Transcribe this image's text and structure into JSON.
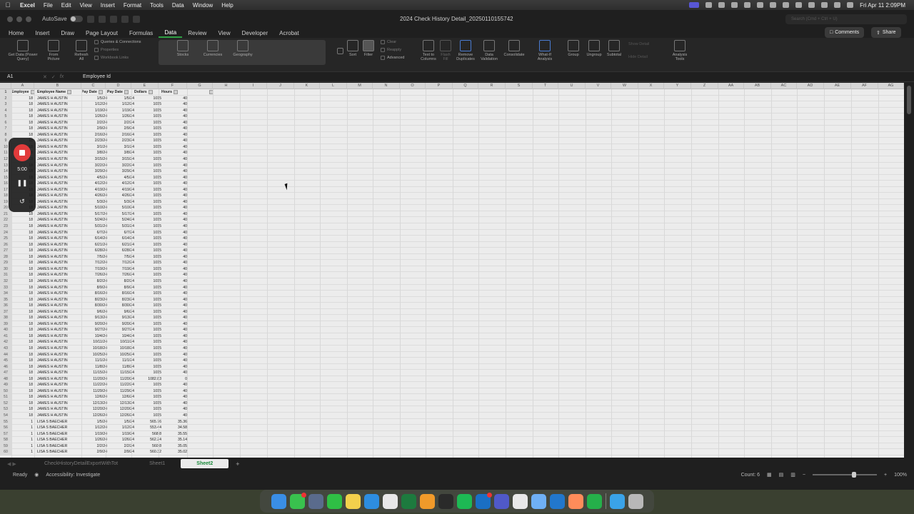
{
  "menubar": {
    "items": [
      "Excel",
      "File",
      "Edit",
      "View",
      "Insert",
      "Format",
      "Tools",
      "Data",
      "Window",
      "Help"
    ],
    "clock": "Fri Apr 11  2:09PM"
  },
  "window": {
    "autosave_label": "AutoSave",
    "title": "2024 Check History Detail_20250110155742",
    "search_placeholder": "Search (Cmd + Ctrl + U)"
  },
  "ribbon": {
    "tabs": [
      "Home",
      "Insert",
      "Draw",
      "Page Layout",
      "Formulas",
      "Data",
      "Review",
      "View",
      "Developer",
      "Acrobat"
    ],
    "active_tab": "Data",
    "comments_label": "Comments",
    "share_label": "Share",
    "get_data": "Get Data (Power\nQuery)",
    "from_picture": "From\nPicture",
    "refresh_all": "Refresh\nAll",
    "queries_connections": "Queries & Connections",
    "properties": "Properties",
    "workbook_links": "Workbook Links",
    "stocks": "Stocks",
    "currencies": "Currencies",
    "geography": "Geography",
    "sort": "Sort",
    "filter": "Filter",
    "clear": "Clear",
    "reapply": "Reapply",
    "advanced": "Advanced",
    "text_to_columns": "Text to\nColumns",
    "flash_fill": "Flash\nFill",
    "remove_duplicates": "Remove\nDuplicates",
    "data_validation": "Data\nValidation",
    "consolidate": "Consolidate",
    "what_if": "What-If\nAnalysis",
    "group": "Group",
    "ungroup": "Ungroup",
    "subtotal": "Subtotal",
    "show_detail": "Show Detail",
    "hide_detail": "Hide Detail",
    "analysis_tools": "Analysis\nTools"
  },
  "formula_bar": {
    "name_box": "A1",
    "fx": "fx",
    "value": "Employee Id"
  },
  "columns": [
    "A",
    "B",
    "C",
    "D",
    "E",
    "F",
    "G",
    "H",
    "I",
    "J",
    "K",
    "L",
    "M",
    "N",
    "O",
    "P",
    "Q",
    "R",
    "S",
    "T",
    "U",
    "V",
    "W",
    "X",
    "Y",
    "Z",
    "AA",
    "AB",
    "AC",
    "AD",
    "AE",
    "AF",
    "AG"
  ],
  "headers": [
    "Employee",
    "Employee Name",
    "Pay Date",
    "Pay Date",
    "Dollars",
    "Hours"
  ],
  "rows": [
    [
      "2",
      "18",
      "JAMES H AUSTIN",
      "1/5/24",
      "1/5/24",
      "1015",
      "40"
    ],
    [
      "3",
      "18",
      "JAMES H AUSTIN",
      "1/12/24",
      "1/12/24",
      "1015",
      "40"
    ],
    [
      "4",
      "18",
      "JAMES H AUSTIN",
      "1/19/24",
      "1/19/24",
      "1015",
      "40"
    ],
    [
      "5",
      "18",
      "JAMES H AUSTIN",
      "1/26/24",
      "1/26/24",
      "1015",
      "40"
    ],
    [
      "6",
      "18",
      "JAMES H AUSTIN",
      "2/2/24",
      "2/2/24",
      "1015",
      "40"
    ],
    [
      "7",
      "18",
      "JAMES H AUSTIN",
      "2/9/24",
      "2/9/24",
      "1015",
      "40"
    ],
    [
      "8",
      "18",
      "JAMES H AUSTIN",
      "2/16/24",
      "2/16/24",
      "1015",
      "40"
    ],
    [
      "9",
      "18",
      "JAMES H AUSTIN",
      "2/23/24",
      "2/23/24",
      "1015",
      "40"
    ],
    [
      "10",
      "18",
      "JAMES H AUSTIN",
      "3/1/24",
      "3/1/24",
      "1015",
      "40"
    ],
    [
      "11",
      "18",
      "JAMES H AUSTIN",
      "3/8/24",
      "3/8/24",
      "1015",
      "40"
    ],
    [
      "12",
      "18",
      "JAMES H AUSTIN",
      "3/15/24",
      "3/15/24",
      "1015",
      "40"
    ],
    [
      "13",
      "18",
      "JAMES H AUSTIN",
      "3/22/24",
      "3/22/24",
      "1015",
      "40"
    ],
    [
      "14",
      "18",
      "JAMES H AUSTIN",
      "3/29/24",
      "3/29/24",
      "1015",
      "40"
    ],
    [
      "15",
      "18",
      "JAMES H AUSTIN",
      "4/5/24",
      "4/5/24",
      "1015",
      "40"
    ],
    [
      "16",
      "18",
      "JAMES H AUSTIN",
      "4/12/24",
      "4/12/24",
      "1015",
      "40"
    ],
    [
      "17",
      "18",
      "JAMES H AUSTIN",
      "4/19/24",
      "4/19/24",
      "1015",
      "40"
    ],
    [
      "18",
      "18",
      "JAMES H AUSTIN",
      "4/26/24",
      "4/26/24",
      "1015",
      "40"
    ],
    [
      "19",
      "18",
      "JAMES H AUSTIN",
      "5/3/24",
      "5/3/24",
      "1015",
      "40"
    ],
    [
      "20",
      "18",
      "JAMES H AUSTIN",
      "5/10/24",
      "5/10/24",
      "1015",
      "40"
    ],
    [
      "21",
      "18",
      "JAMES H AUSTIN",
      "5/17/24",
      "5/17/24",
      "1015",
      "40"
    ],
    [
      "22",
      "18",
      "JAMES H AUSTIN",
      "5/24/24",
      "5/24/24",
      "1015",
      "40"
    ],
    [
      "23",
      "18",
      "JAMES H AUSTIN",
      "5/31/24",
      "5/31/24",
      "1015",
      "40"
    ],
    [
      "24",
      "18",
      "JAMES H AUSTIN",
      "6/7/24",
      "6/7/24",
      "1015",
      "40"
    ],
    [
      "25",
      "18",
      "JAMES H AUSTIN",
      "6/14/24",
      "6/14/24",
      "1015",
      "40"
    ],
    [
      "26",
      "18",
      "JAMES H AUSTIN",
      "6/21/24",
      "6/21/24",
      "1015",
      "40"
    ],
    [
      "27",
      "18",
      "JAMES H AUSTIN",
      "6/28/24",
      "6/28/24",
      "1015",
      "40"
    ],
    [
      "28",
      "18",
      "JAMES H AUSTIN",
      "7/5/24",
      "7/5/24",
      "1015",
      "40"
    ],
    [
      "29",
      "18",
      "JAMES H AUSTIN",
      "7/12/24",
      "7/12/24",
      "1015",
      "40"
    ],
    [
      "30",
      "18",
      "JAMES H AUSTIN",
      "7/19/24",
      "7/19/24",
      "1015",
      "40"
    ],
    [
      "31",
      "18",
      "JAMES H AUSTIN",
      "7/26/24",
      "7/26/24",
      "1015",
      "40"
    ],
    [
      "32",
      "18",
      "JAMES H AUSTIN",
      "8/2/24",
      "8/2/24",
      "1015",
      "40"
    ],
    [
      "33",
      "18",
      "JAMES H AUSTIN",
      "8/9/24",
      "8/9/24",
      "1015",
      "40"
    ],
    [
      "34",
      "18",
      "JAMES H AUSTIN",
      "8/16/24",
      "8/16/24",
      "1015",
      "40"
    ],
    [
      "35",
      "18",
      "JAMES H AUSTIN",
      "8/23/24",
      "8/23/24",
      "1015",
      "40"
    ],
    [
      "36",
      "18",
      "JAMES H AUSTIN",
      "8/30/24",
      "8/30/24",
      "1015",
      "40"
    ],
    [
      "37",
      "18",
      "JAMES H AUSTIN",
      "9/6/24",
      "9/6/24",
      "1015",
      "40"
    ],
    [
      "38",
      "18",
      "JAMES H AUSTIN",
      "9/13/24",
      "9/13/24",
      "1015",
      "40"
    ],
    [
      "39",
      "18",
      "JAMES H AUSTIN",
      "9/20/24",
      "9/20/24",
      "1015",
      "40"
    ],
    [
      "40",
      "18",
      "JAMES H AUSTIN",
      "9/27/24",
      "9/27/24",
      "1015",
      "40"
    ],
    [
      "41",
      "18",
      "JAMES H AUSTIN",
      "10/4/24",
      "10/4/24",
      "1015",
      "40"
    ],
    [
      "42",
      "18",
      "JAMES H AUSTIN",
      "10/11/24",
      "10/11/24",
      "1015",
      "40"
    ],
    [
      "43",
      "18",
      "JAMES H AUSTIN",
      "10/18/24",
      "10/18/24",
      "1015",
      "40"
    ],
    [
      "44",
      "18",
      "JAMES H AUSTIN",
      "10/25/24",
      "10/25/24",
      "1015",
      "40"
    ],
    [
      "45",
      "18",
      "JAMES H AUSTIN",
      "11/1/24",
      "11/1/24",
      "1015",
      "40"
    ],
    [
      "46",
      "18",
      "JAMES H AUSTIN",
      "11/8/24",
      "11/8/24",
      "1015",
      "40"
    ],
    [
      "47",
      "18",
      "JAMES H AUSTIN",
      "11/15/24",
      "11/15/24",
      "1015",
      "40"
    ],
    [
      "48",
      "18",
      "JAMES H AUSTIN",
      "11/20/24",
      "11/20/24",
      "1082.83",
      "0"
    ],
    [
      "49",
      "18",
      "JAMES H AUSTIN",
      "11/22/24",
      "11/22/24",
      "1015",
      "40"
    ],
    [
      "50",
      "18",
      "JAMES H AUSTIN",
      "11/29/24",
      "11/29/24",
      "1015",
      "40"
    ],
    [
      "51",
      "18",
      "JAMES H AUSTIN",
      "12/6/24",
      "12/6/24",
      "1015",
      "40"
    ],
    [
      "52",
      "18",
      "JAMES H AUSTIN",
      "12/13/24",
      "12/13/24",
      "1015",
      "40"
    ],
    [
      "53",
      "18",
      "JAMES H AUSTIN",
      "12/20/24",
      "12/20/24",
      "1015",
      "40"
    ],
    [
      "54",
      "18",
      "JAMES H AUSTIN",
      "12/26/24",
      "12/26/24",
      "1015",
      "40"
    ],
    [
      "55",
      "1",
      "LISA S BAECHER",
      "1/5/24",
      "1/5/24",
      "565.76",
      "35.36"
    ],
    [
      "56",
      "1",
      "LISA S BAECHER",
      "1/12/24",
      "1/12/24",
      "553.44",
      "34.58"
    ],
    [
      "57",
      "1",
      "LISA S BAECHER",
      "1/19/24",
      "1/19/24",
      "568.8",
      "35.55"
    ],
    [
      "58",
      "1",
      "LISA S BAECHER",
      "1/26/24",
      "1/26/24",
      "562.24",
      "35.14"
    ],
    [
      "59",
      "1",
      "LISA S BAECHER",
      "2/2/24",
      "2/2/24",
      "560.8",
      "35.05"
    ],
    [
      "60",
      "1",
      "LISA S BAECHER",
      "2/9/24",
      "2/9/24",
      "560.32",
      "35.02"
    ]
  ],
  "sheets": [
    "CheckHistoryDetailExportWithTot",
    "Sheet1",
    "Sheet2"
  ],
  "active_sheet": "Sheet2",
  "status": {
    "ready": "Ready",
    "accessibility": "Accessibility: Investigate",
    "count": "Count: 6",
    "zoom": "100%"
  },
  "recorder": {
    "time": "5:00"
  },
  "dock_icons": [
    "finder-icon",
    "messages-icon",
    "preview-icon",
    "facetime-icon",
    "notes-icon",
    "safari-icon",
    "textedit-icon",
    "excel-icon",
    "pages-icon",
    "chatgpt-icon",
    "spotify-icon",
    "outlook-icon",
    "teams-icon",
    "chrome-icon",
    "screen-sharing-icon",
    "vscode-icon",
    "photos-icon",
    "numbers-icon",
    "folder-icon",
    "trash-icon"
  ],
  "colors": {
    "accent": "#2ea043",
    "record": "#e23b3b"
  }
}
